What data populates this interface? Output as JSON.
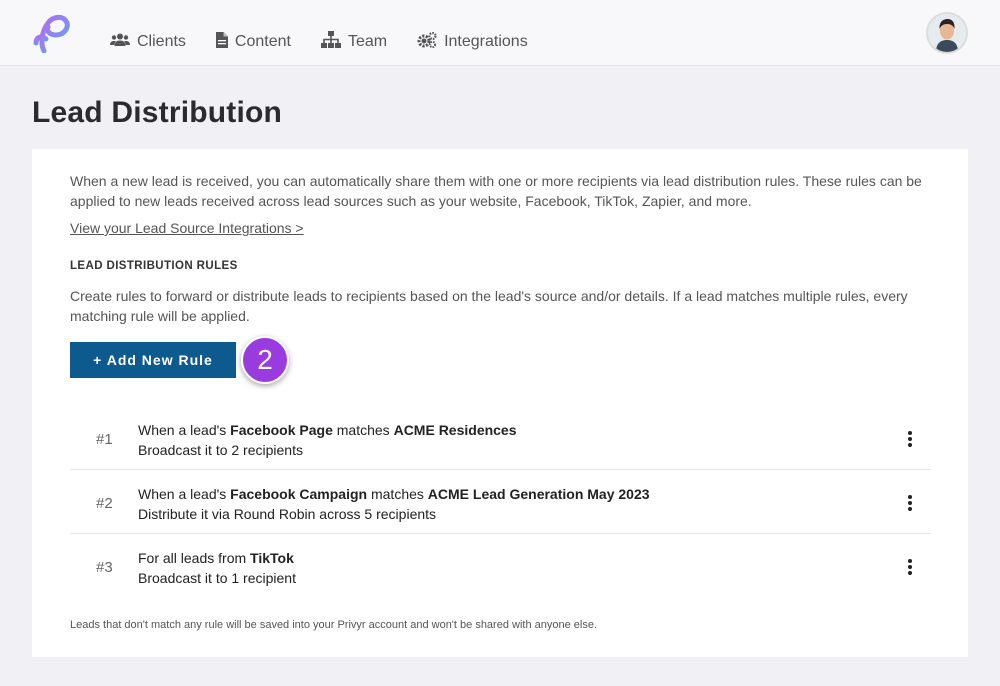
{
  "nav": {
    "items": [
      {
        "label": "Clients",
        "icon": "users-icon"
      },
      {
        "label": "Content",
        "icon": "document-icon"
      },
      {
        "label": "Team",
        "icon": "sitemap-icon"
      },
      {
        "label": "Integrations",
        "icon": "gears-icon"
      }
    ]
  },
  "page": {
    "title": "Lead Distribution"
  },
  "intro": "When a new lead is received, you can automatically share them with one or more recipients via lead distribution rules. These rules can be applied to new leads received across lead sources such as your website, Facebook, TikTok, Zapier, and more.",
  "integrations_link": "View your Lead Source Integrations >",
  "rules_section": {
    "heading": "LEAD DISTRIBUTION RULES",
    "description": "Create rules to forward or distribute leads to recipients based on the lead's source and/or details. If a lead matches multiple rules, every matching rule will be applied.",
    "add_button": "+ Add New Rule",
    "step_badge": "2"
  },
  "rules": [
    {
      "number": "#1",
      "p1": "When a lead's ",
      "b1": "Facebook Page",
      "p2": " matches ",
      "b2": "ACME Residences",
      "action": "Broadcast it to 2 recipients"
    },
    {
      "number": "#2",
      "p1": "When a lead's ",
      "b1": "Facebook Campaign",
      "p2": " matches ",
      "b2": "ACME Lead Generation May 2023",
      "action": "Distribute it via Round Robin across 5 recipients"
    },
    {
      "number": "#3",
      "p1": "For all leads from ",
      "b1": "TikTok",
      "p2": "",
      "b2": "",
      "action": "Broadcast it to 1 recipient"
    }
  ],
  "footer_note": "Leads that don't match any rule will be saved into your Privyr account and won't be shared with anyone else.",
  "colors": {
    "accent": "#0d5b8e",
    "badge": "#9a3be0",
    "background": "#f0f0f5"
  }
}
